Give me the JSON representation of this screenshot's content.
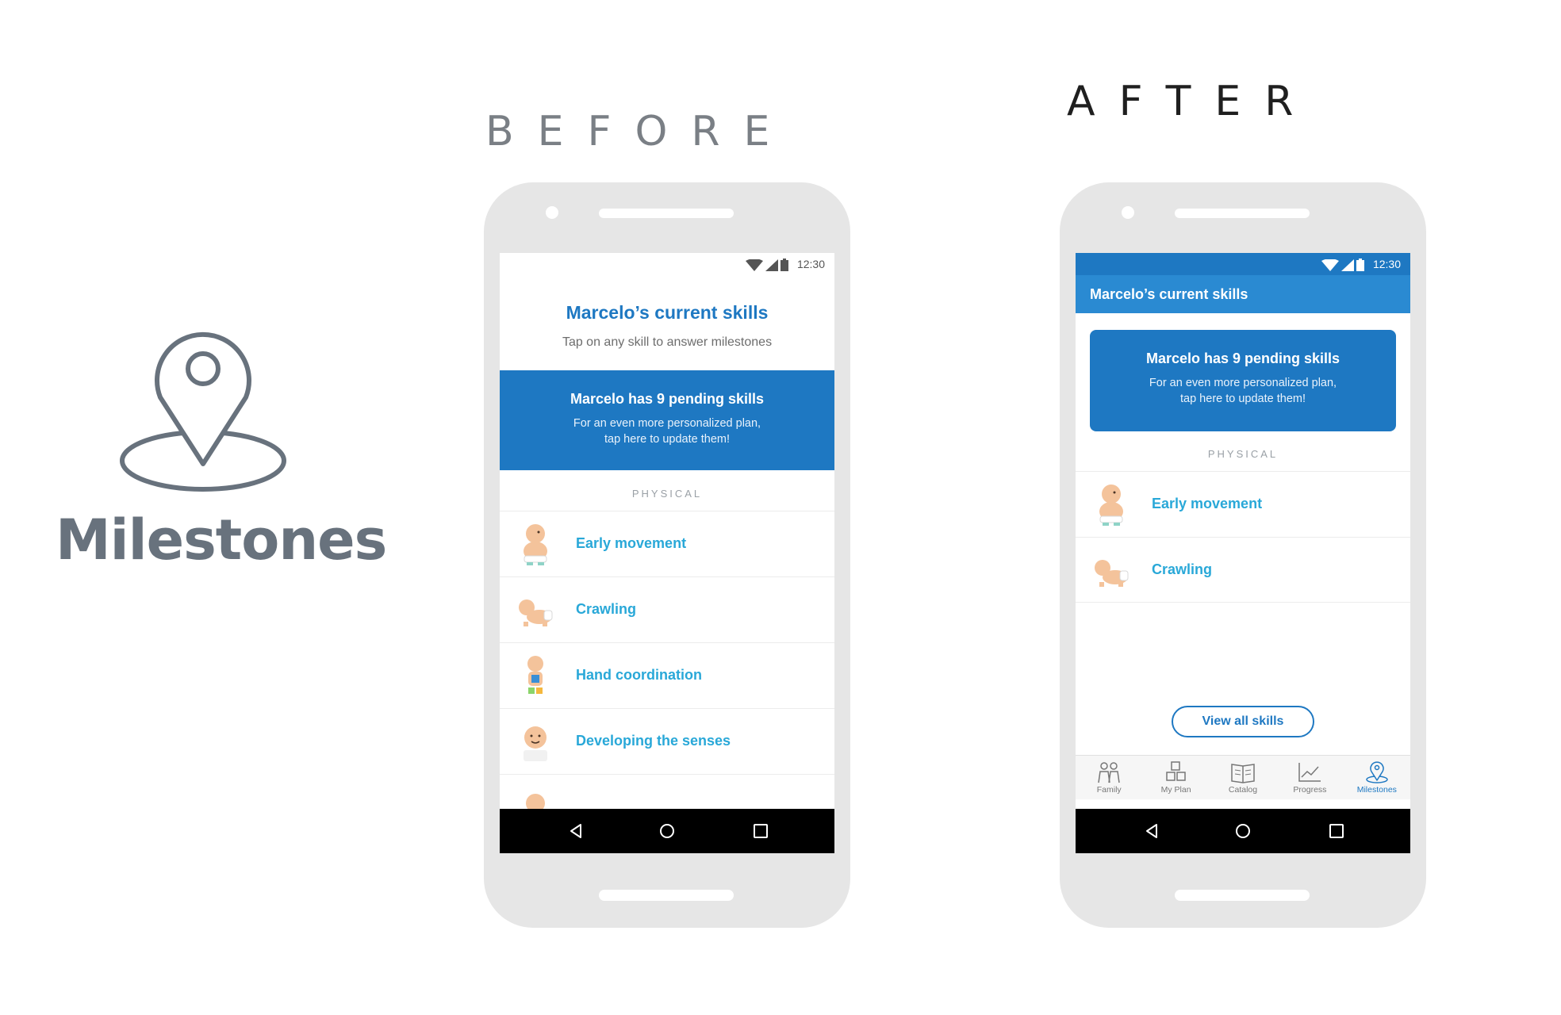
{
  "feature": {
    "title": "Milestones",
    "icon": "map-pin-icon"
  },
  "headings": {
    "before": "BEFORE",
    "after": "AFTER"
  },
  "status_bar": {
    "time": "12:30",
    "icons": [
      "wifi-icon",
      "signal-icon",
      "battery-icon"
    ]
  },
  "before_screen": {
    "title": "Marcelo’s current skills",
    "subtitle": "Tap on any skill to answer milestones",
    "pending": {
      "title": "Marcelo has 9 pending skills",
      "line1": "For an even more personalized plan,",
      "line2": "tap here to update them!"
    },
    "section": "PHYSICAL",
    "skills": [
      {
        "label": "Early movement",
        "icon": "baby-sitting-icon"
      },
      {
        "label": "Crawling",
        "icon": "baby-crawling-icon"
      },
      {
        "label": "Hand coordination",
        "icon": "baby-blocks-icon"
      },
      {
        "label": "Developing the senses",
        "icon": "baby-face-icon"
      }
    ]
  },
  "after_screen": {
    "header_title": "Marcelo’s current skills",
    "pending": {
      "title": "Marcelo has 9 pending skills",
      "line1": "For an even more personalized plan,",
      "line2": "tap here to update them!"
    },
    "section": "PHYSICAL",
    "skills": [
      {
        "label": "Early movement",
        "icon": "baby-sitting-icon"
      },
      {
        "label": "Crawling",
        "icon": "baby-crawling-icon"
      }
    ],
    "view_all_label": "View all skills",
    "tabs": [
      {
        "label": "Family",
        "icon": "family-icon",
        "active": false
      },
      {
        "label": "My Plan",
        "icon": "blocks-icon",
        "active": false
      },
      {
        "label": "Catalog",
        "icon": "book-icon",
        "active": false
      },
      {
        "label": "Progress",
        "icon": "chart-icon",
        "active": false
      },
      {
        "label": "Milestones",
        "icon": "map-pin-icon",
        "active": true
      }
    ]
  },
  "android_nav": [
    "back-icon",
    "home-icon",
    "recents-icon"
  ],
  "colors": {
    "primary": "#1e78c2",
    "header_blue": "#2a8ad2",
    "skill_text": "#29a8d8",
    "icon_grey": "#68727d"
  }
}
